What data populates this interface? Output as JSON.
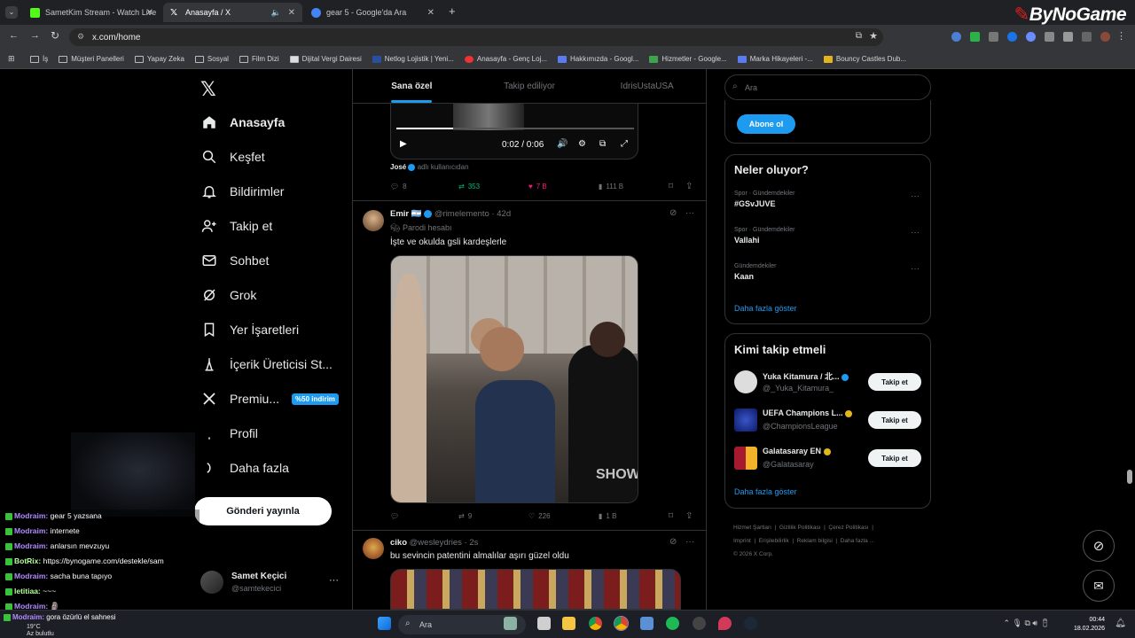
{
  "browser": {
    "tabs": [
      {
        "title": "SametKim Stream - Watch Live",
        "favicon_color": "#53fc18"
      },
      {
        "title": "Anasayfa / X",
        "favicon_color": "#ffffff"
      },
      {
        "title": "gear 5 - Google'da Ara",
        "favicon_color": "#4285f4"
      }
    ],
    "new_tab": "+",
    "url": "x.com/home",
    "bookmarks": [
      "İş",
      "Müşteri Panelleri",
      "Yapay Zeka",
      "Sosyal",
      "Film Dizi",
      "Dijital Vergi Dairesi",
      "Netlog Lojistik | Yeni...",
      "Anasayfa - Genç Loj...",
      "Hakkımızda - Googl...",
      "Hizmetler - Google...",
      "Marka Hikayeleri -...",
      "Bouncy Castles Dub..."
    ]
  },
  "overlay": {
    "brand_a": "By",
    "brand_b": "NoGame"
  },
  "sidebar": {
    "nav": [
      {
        "label": "Anasayfa",
        "icon": "home-icon"
      },
      {
        "label": "Keşfet",
        "icon": "search-icon"
      },
      {
        "label": "Bildirimler",
        "icon": "bell-icon"
      },
      {
        "label": "Takip et",
        "icon": "add-user-icon"
      },
      {
        "label": "Sohbet",
        "icon": "mail-icon"
      },
      {
        "label": "Grok",
        "icon": "grok-icon"
      },
      {
        "label": "Yer İşaretleri",
        "icon": "bookmark-icon"
      },
      {
        "label": "İçerik Üreticisi St...",
        "icon": "creator-icon"
      },
      {
        "label": "Premiu...",
        "icon": "x-icon"
      },
      {
        "label": "Profil",
        "icon": "profile-icon"
      },
      {
        "label": "Daha fazla",
        "icon": "more-icon"
      }
    ],
    "premium_badge": "%50 indirim",
    "post_button": "Gönderi yayınla",
    "account": {
      "name": "Samet Keçici",
      "handle": "@samtekecici",
      "menu": "···"
    }
  },
  "feed": {
    "tabs": [
      "Sana özel",
      "Takip ediliyor",
      "IdrisUstaUSA"
    ],
    "post1": {
      "video_time": "0:02 / 0:06",
      "credit_name": "José",
      "credit_text": "adlı kullanıcıdan",
      "replies": "8",
      "reposts": "353",
      "likes": "7 B",
      "views": "111 B"
    },
    "post2": {
      "name": "Emir",
      "flag": "🇦🇷",
      "handle": "@rimelemento",
      "time": "· 42d",
      "label": "Parodi hesabı",
      "text": "İşte ve okulda gsli kardeşlerle",
      "video_watermark": "SHOWT",
      "replies": "",
      "reposts": "9",
      "likes": "226",
      "views": "1 B"
    },
    "post3": {
      "name": "ciko",
      "handle": "@wesleydries",
      "time": "· 2s",
      "text": "bu sevincin patentini almalılar aşırı güzel oldu"
    }
  },
  "right": {
    "search_placeholder": "Ara",
    "subscribe": "Abone ol",
    "trends_title": "Neler oluyor?",
    "trends": [
      {
        "category": "Spor · Gündemdekiler",
        "name": "#GSvJUVE"
      },
      {
        "category": "Spor · Gündemdekiler",
        "name": "Vallahi"
      },
      {
        "category": "Gündemdekiler",
        "name": "Kaan"
      }
    ],
    "show_more": "Daha fazla göster",
    "who_title": "Kimi takip etmeli",
    "who": [
      {
        "name": "Yuka Kitamura / 北...",
        "handle": "@_Yuka_Kitamura_",
        "button": "Takip et"
      },
      {
        "name": "UEFA Champions L...",
        "handle": "@ChampionsLeague",
        "button": "Takip et"
      },
      {
        "name": "Galatasaray EN",
        "handle": "@Galatasaray",
        "button": "Takip et"
      }
    ],
    "footer": [
      "Hizmet Şartları",
      "Gizlilik Politikası",
      "Çerez Politikası",
      "Imprint",
      "Erişilebilirlik",
      "Reklam bilgisi",
      "Daha fazla ...",
      "© 2026 X Corp."
    ]
  },
  "chat": [
    {
      "user": "Modraim:",
      "msg": "gear 5 yazsana"
    },
    {
      "user": "Modraim:",
      "msg": "internete"
    },
    {
      "user": "Modraim:",
      "msg": "anlarsın mevzuyu"
    },
    {
      "user": "BotRix:",
      "msg": "https://bynogame.com/destekle/sam"
    },
    {
      "user": "Modraim:",
      "msg": "sacha buna tapıyo"
    },
    {
      "user": "letitiaa:",
      "msg": "~~~"
    },
    {
      "user": "Modraim:",
      "msg": "🗿"
    },
    {
      "user": "Modraim:",
      "msg": "gora özürlü el sahnesi"
    }
  ],
  "taskbar": {
    "search": "Ara",
    "weather_temp": "19°C",
    "weather_desc": "Az bulutlu",
    "time": "00:44",
    "date": "18.02.2026"
  }
}
